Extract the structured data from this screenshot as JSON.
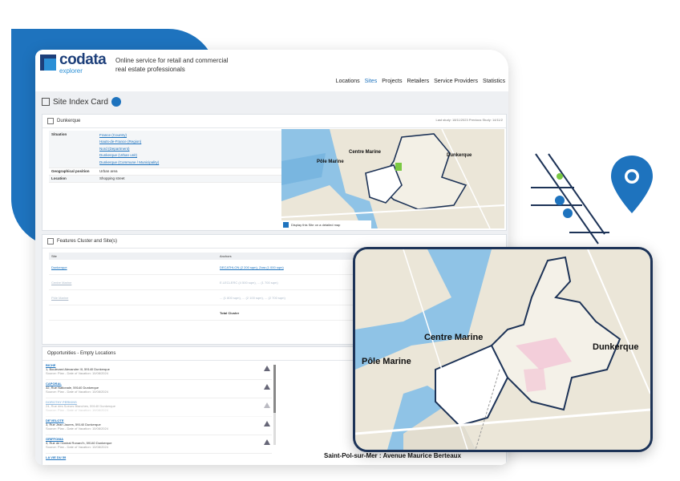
{
  "brand": {
    "name": "codata",
    "sub": "explorer",
    "tagline": "Online service for retail and commercial real estate professionals"
  },
  "nav": [
    "Locations",
    "Sites",
    "Projects",
    "Retailers",
    "Service Providers",
    "Statistics"
  ],
  "nav_active": "Sites",
  "page": {
    "title": "Site Index Card"
  },
  "site": {
    "name": "Dunkerque",
    "dates": "Last study: 18/11/2023   Previous Study: 14/11/2",
    "situation_label": "Situation",
    "situation": [
      "France (Country)",
      "Hauts-de-France (Region)",
      "Nord (Department)",
      "Dunkerque (Urban unit)",
      "Dunkerque (Commune / Municipality)"
    ],
    "geo_label": "Geographical position",
    "geo_value": "Urban area",
    "location_label": "Location",
    "location_value": "Shopping street",
    "map_caption": "Display this Site on a detailed map"
  },
  "map_labels": {
    "centre": "Centre Marine",
    "pole": "Pôle Marine",
    "dunkerque": "Dunkerque",
    "saint_pol": "Saint-Pol-sur-Mer : Avenue Maurice Berteaux"
  },
  "features": {
    "title": "Features Cluster and Site(s)",
    "col_site": "Site",
    "col_anchors": "Anchors",
    "rows": [
      {
        "site": "Dunkerque",
        "anchors": "DECATHLON (2 200 sqm), Zara (1 000 sqm)"
      },
      {
        "site": "Centre Marine",
        "anchors": "E.LECLERC (4 500 sqm), ... (1 700 sqm)"
      },
      {
        "site": "Pôle Marine",
        "anchors": "... (1 800 sqm), ... (2 100 sqm), ... (2 700 sqm)"
      }
    ],
    "total_label": "Total Cluster"
  },
  "opportunities": {
    "title": "Opportunities - Empty Locations",
    "items": [
      {
        "title": "BICHE",
        "address": "1, Boulevard Alexandre III, 59140 Dunkerque",
        "sub": "Source: Plan - Date of Vacation: 10/08/2024",
        "faded": false
      },
      {
        "title": "CAPORAL",
        "address": "32, Rue Nationale, 59140 Dunkerque",
        "sub": "Source: Plan - Date of Vacation: 10/08/2024",
        "faded": false
      },
      {
        "title": "DOROTHY PERKINS",
        "address": "24, Rue des Soeurs Blanches, 59140 Dunkerque",
        "sub": "Source: Plan - Date of Vacation: 10/08/2024",
        "faded": true
      },
      {
        "title": "DE'VELOTE",
        "address": "3, Rue Jean Jaures, 59140 Dunkerque",
        "sub": "Source: Plan - Date of Vacation: 10/08/2024",
        "faded": false
      },
      {
        "title": "GRIFFONIA",
        "address": "3, Rue de l'Amiral Ronarc'h, 59140 Dunkerque",
        "sub": "Source: Plan - Date of Vacation: 10/08/2024",
        "faded": false
      },
      {
        "title": "LA VIE DU 59",
        "address": "",
        "sub": "",
        "faded": false
      }
    ]
  },
  "colors": {
    "brand_dark": "#1d3f7a",
    "brand_blue": "#1e73be",
    "green_marker": "#7ac943"
  },
  "icons": [
    "location-pin-icon",
    "building-icon",
    "info-icon",
    "warning-icon",
    "map-icon"
  ]
}
